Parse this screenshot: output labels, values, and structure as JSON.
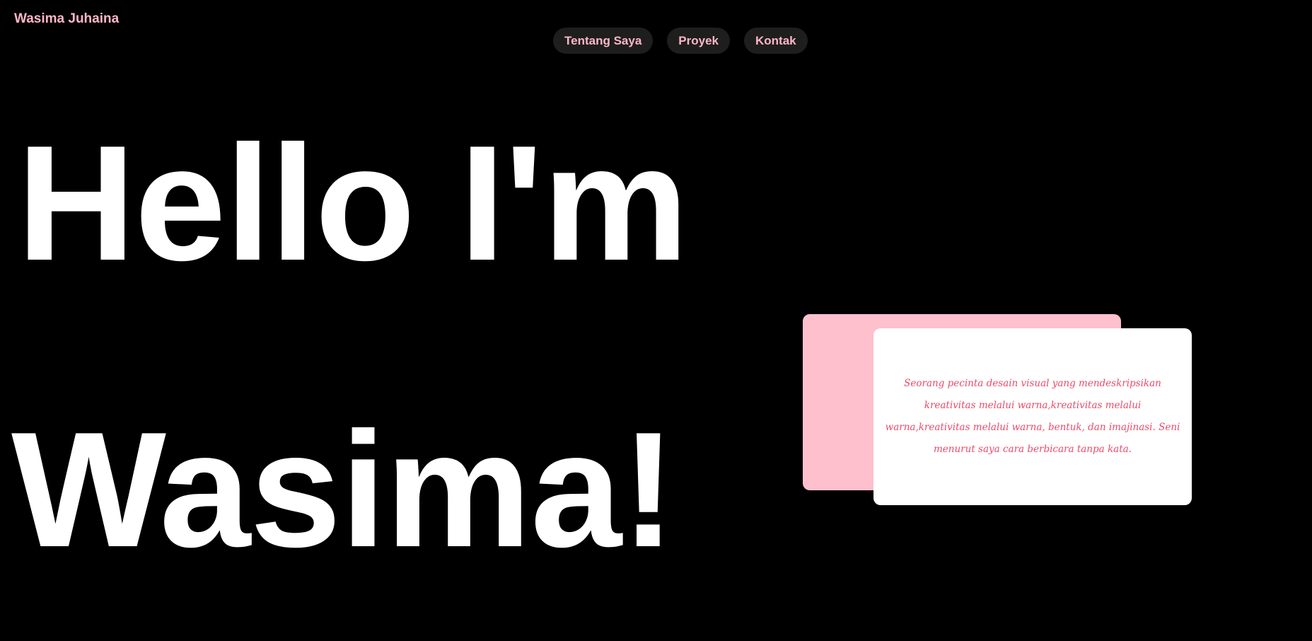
{
  "header": {
    "brand": "Wasima Juhaina"
  },
  "nav": {
    "items": [
      {
        "label": "Tentang Saya"
      },
      {
        "label": "Proyek"
      },
      {
        "label": "Kontak"
      }
    ]
  },
  "hero": {
    "line1": "Hello I'm",
    "line2": "Wasima!"
  },
  "card": {
    "text": "Seorang pecinta desain visual yang mendeskripsikan kreativitas melalui warna,kreativitas melalui warna,kreativitas melalui warna, bentuk, dan imajinasi. Seni menurut saya cara berbicara tanpa kata."
  },
  "colors": {
    "background": "#000000",
    "accent_pink": "#ffb6c8",
    "card_back": "#ffc0cd",
    "card_front": "#ffffff",
    "card_text": "#e94b6a",
    "nav_pill": "#1e1e1e",
    "hero_text": "#ffffff"
  }
}
